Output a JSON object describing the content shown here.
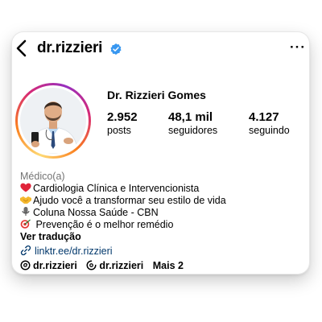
{
  "header": {
    "username": "dr.rizzieri",
    "back_icon": "chevron-left-icon",
    "verified_icon": "verified-badge-icon",
    "more_icon": "more-horizontal-icon",
    "more_glyph": "···",
    "verified_color": "#3897f0"
  },
  "profile": {
    "display_name": "Dr. Rizzieri Gomes",
    "avatar_icon": "profile-photo-avatar",
    "stats": {
      "posts_value": "2.952",
      "posts_label": "posts",
      "followers_value": "48,1 mil",
      "followers_label": "seguidores",
      "following_value": "4.127",
      "following_label": "seguindo"
    }
  },
  "bio": {
    "category": "Médico(a)",
    "lines": [
      {
        "icon": "red-heart-emoji",
        "text": "Cardiologia Clínica e Intervencionista"
      },
      {
        "icon": "handshake-emoji",
        "text": "Ajudo você a transformar seu estilo de vida"
      },
      {
        "icon": "microphone-emoji",
        "text": "Coluna Nossa Saúde - CBN"
      },
      {
        "icon": "target-emoji",
        "text": " Prevenção é o melhor remédio"
      }
    ],
    "translate_label": "Ver tradução",
    "link": "linktr.ee/dr.rizzieri",
    "link_icon": "link-icon"
  },
  "bottom_links": {
    "threads_label": "dr.rizzieri",
    "threads_icon": "threads-icon",
    "messenger_label": "dr.rizzieri",
    "messenger_icon": "threads-handle-icon",
    "more_label": "Mais 2"
  },
  "colors": {
    "link": "#00376b",
    "category": "#737373",
    "ring_gradient": [
      "#feda75",
      "#fa7e1e",
      "#d62976",
      "#962fbf"
    ]
  }
}
